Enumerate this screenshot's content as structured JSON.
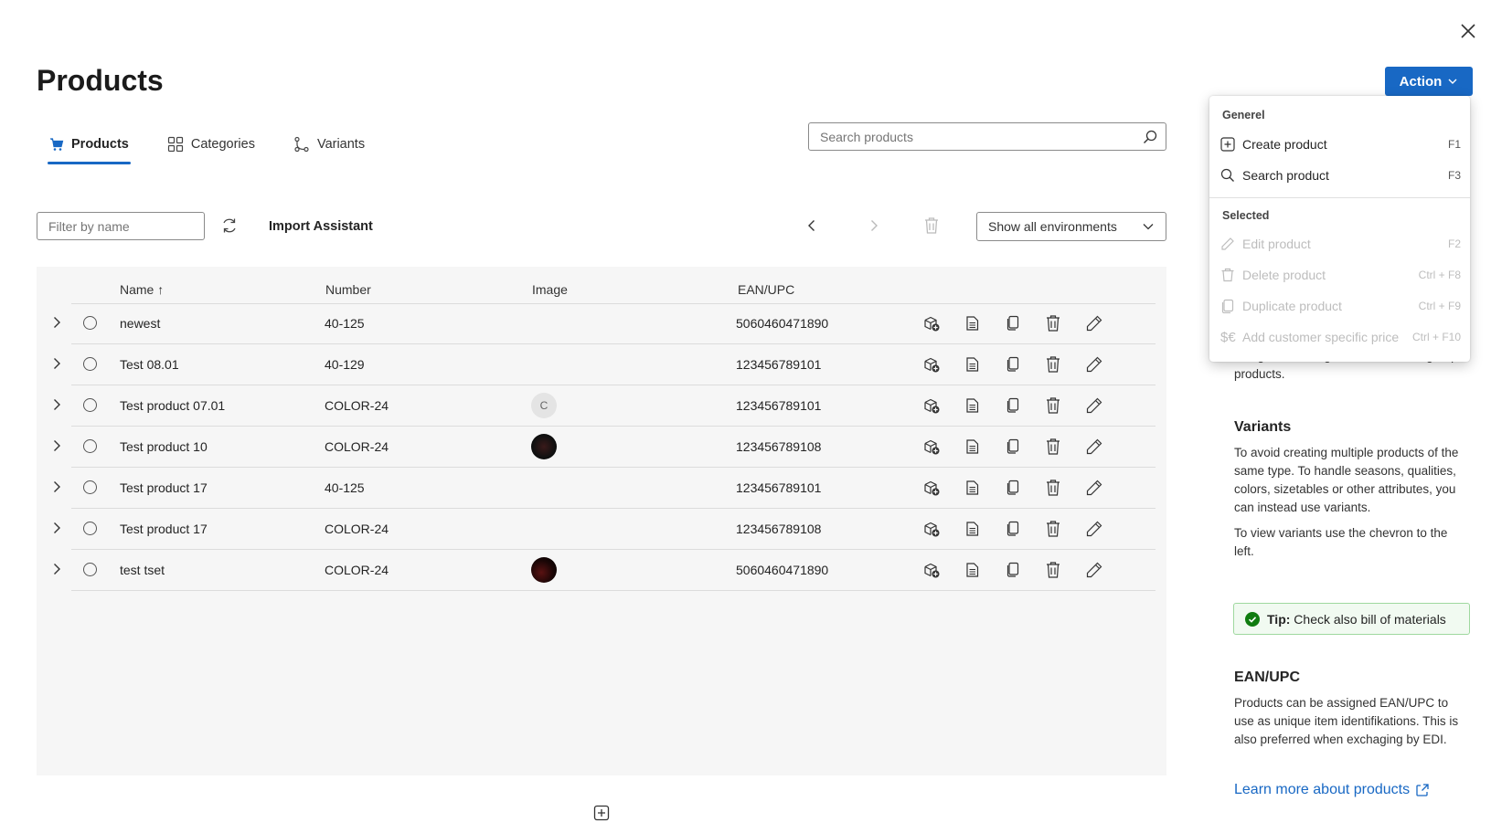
{
  "page": {
    "title": "Products",
    "close_icon": "close-icon"
  },
  "action_button": {
    "label": "Action"
  },
  "tabs": [
    {
      "label": "Products",
      "icon": "cart-icon",
      "active": true
    },
    {
      "label": "Categories",
      "icon": "grid-icon",
      "active": false
    },
    {
      "label": "Variants",
      "icon": "branch-icon",
      "active": false
    }
  ],
  "search": {
    "placeholder": "Search products",
    "value": ""
  },
  "toolbar": {
    "filter_placeholder": "Filter by name",
    "import_label": "Import Assistant",
    "environment_value": "Show all environments"
  },
  "table": {
    "columns": [
      "Name",
      "Number",
      "Image",
      "EAN/UPC"
    ],
    "sort": "Name ascending",
    "rows": [
      {
        "name": "newest",
        "number": "40-125",
        "image": "",
        "ean": "5060460471890"
      },
      {
        "name": "Test 08.01",
        "number": "40-129",
        "image": "",
        "ean": "123456789101"
      },
      {
        "name": "Test product 07.01",
        "number": "COLOR-24",
        "image": "C",
        "ean": "123456789101"
      },
      {
        "name": "Test product 10",
        "number": "COLOR-24",
        "image": "photo",
        "ean": "123456789108"
      },
      {
        "name": "Test product 17",
        "number": "40-125",
        "image": "",
        "ean": "123456789101"
      },
      {
        "name": "Test product 17",
        "number": "COLOR-24",
        "image": "",
        "ean": "123456789108"
      },
      {
        "name": "test tset",
        "number": "COLOR-24",
        "image": "photo",
        "ean": "5060460471890"
      }
    ]
  },
  "action_menu": {
    "section_general": "Generel",
    "section_selected": "Selected",
    "items": [
      {
        "label": "Create product",
        "shortcut": "F1",
        "icon": "plus-square-icon",
        "disabled": false
      },
      {
        "label": "Search product",
        "shortcut": "F3",
        "icon": "search-icon",
        "disabled": false
      },
      {
        "label": "Edit product",
        "shortcut": "F2",
        "icon": "pencil-icon",
        "disabled": true
      },
      {
        "label": "Delete product",
        "shortcut": "Ctrl + F8",
        "icon": "trash-icon",
        "disabled": true
      },
      {
        "label": "Duplicate product",
        "shortcut": "Ctrl + F9",
        "icon": "copy-icon",
        "disabled": true
      },
      {
        "label": "Add customer specific price",
        "shortcut": "Ctrl + F10",
        "icon": "price-icon",
        "disabled": true
      }
    ]
  },
  "help": {
    "categories_tail": "categories. Categories are used to group products.",
    "variants_heading": "Variants",
    "variants_text_1": "To avoid creating multiple products of the same type. To handle seasons, qualities, colors, sizetables or other attributes, you can instead use variants.",
    "variants_text_2": "To view variants use the chevron to the left.",
    "tip_prefix": "Tip:",
    "tip_text": "Check also bill of materials",
    "ean_heading": "EAN/UPC",
    "ean_text": "Products can be assigned EAN/UPC to use as unique item identifikations. This is also preferred when exchaging by EDI.",
    "learn_more": "Learn more about products"
  },
  "colors": {
    "accent": "#1868c4",
    "tip_green": "#107c10"
  }
}
